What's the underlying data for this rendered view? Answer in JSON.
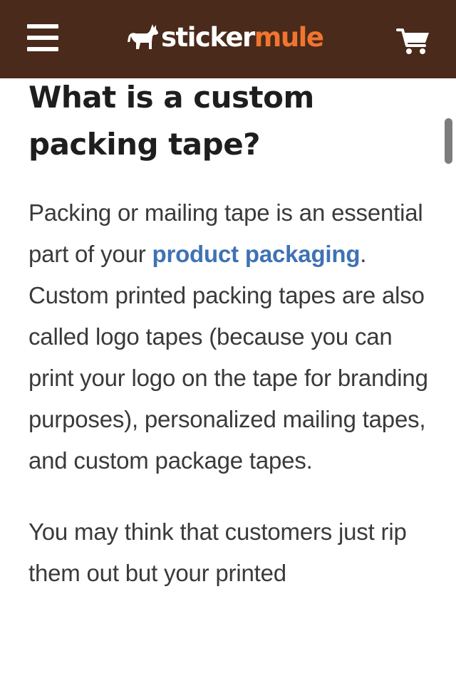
{
  "header": {
    "menu_icon": "hamburger-menu-icon",
    "logo_icon": "mule-icon",
    "logo_part1": "sticker",
    "logo_part2": "mule",
    "cart_icon": "shopping-cart-icon",
    "colors": {
      "background": "#4a2a1a",
      "brand_accent": "#f07530"
    }
  },
  "article": {
    "heading": "What is a custom packing tape?",
    "paragraph1": {
      "before": "Packing or mailing tape is an essential part of your ",
      "link": "product packaging",
      "after": ". Custom printed packing tapes are also called logo tapes (because you can print your logo on the tape for branding purposes), personalized mailing tapes, and custom package tapes."
    },
    "paragraph2": "You may think that customers just rip them out but your printed",
    "colors": {
      "link": "#3f72b4",
      "heading": "#1e1e1e"
    }
  }
}
